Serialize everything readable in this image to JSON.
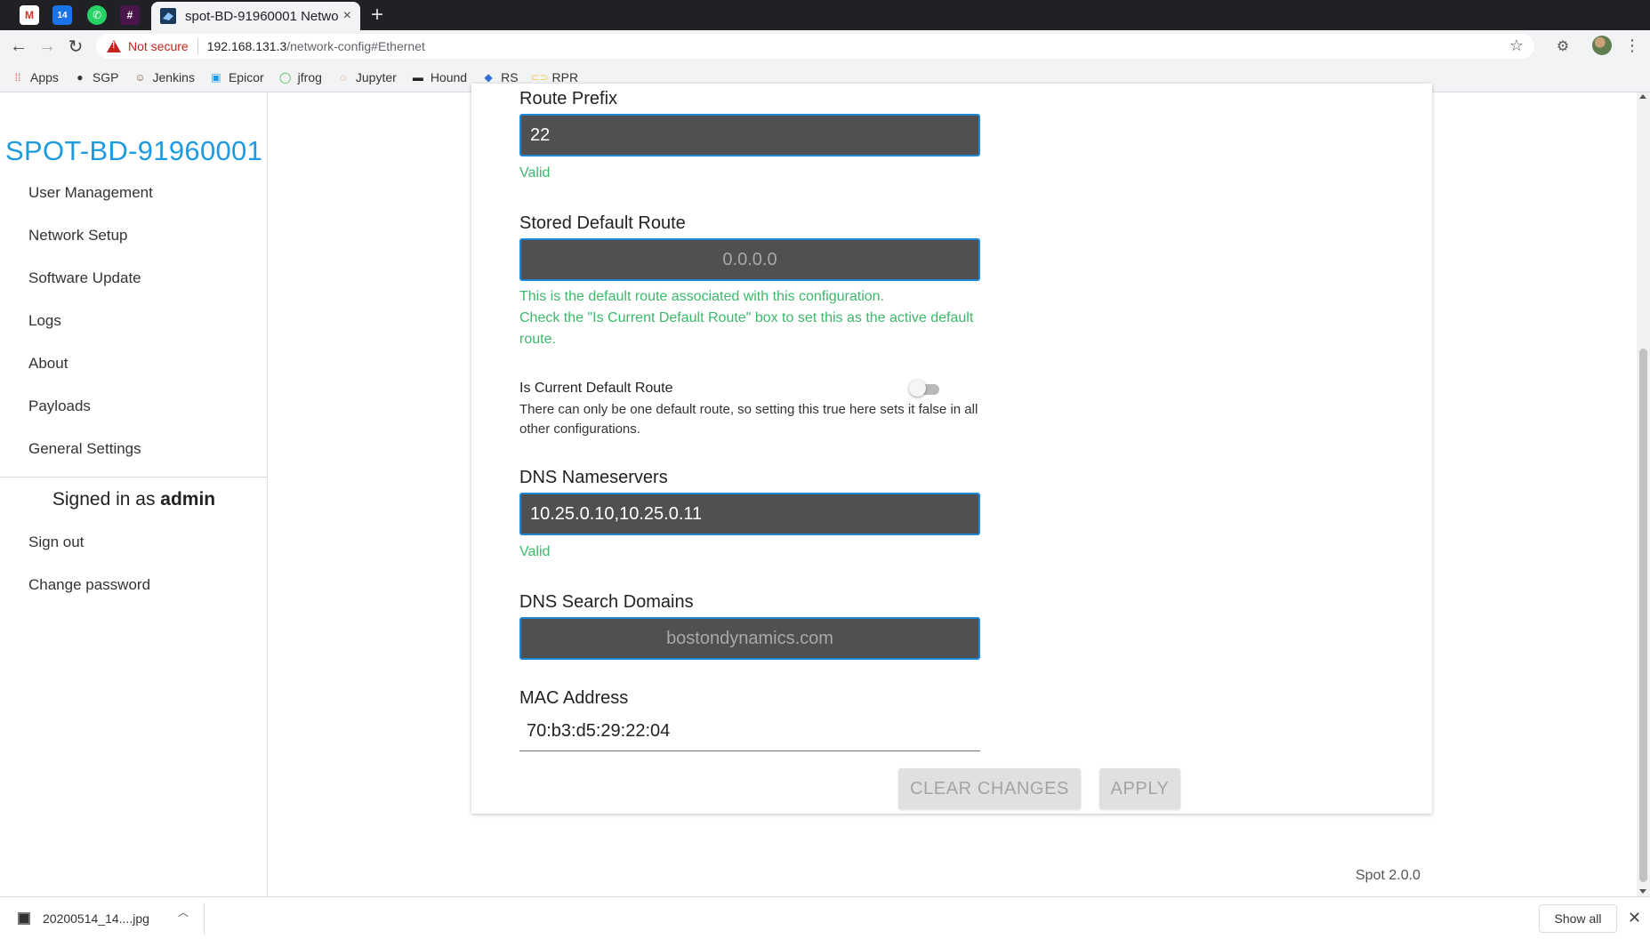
{
  "browser": {
    "tab_title": "spot-BD-91960001 Netwo",
    "tab_close": "×",
    "new_tab": "+",
    "not_secure": "Not secure",
    "url_host": "192.168.131.3",
    "url_path": "/network-config#Ethernet",
    "pinned_tab_badge": "14",
    "bookmarks": [
      {
        "label": "Apps",
        "icon": "apps-grid-icon"
      },
      {
        "label": "SGP",
        "icon": "globe-icon"
      },
      {
        "label": "Jenkins",
        "icon": "jenkins-icon"
      },
      {
        "label": "Epicor",
        "icon": "epicor-icon"
      },
      {
        "label": "jfrog",
        "icon": "jfrog-icon"
      },
      {
        "label": "Jupyter",
        "icon": "jupyter-icon"
      },
      {
        "label": "Hound",
        "icon": "hound-icon"
      },
      {
        "label": "RS",
        "icon": "diamond-icon"
      },
      {
        "label": "RPR",
        "icon": "link-icon"
      }
    ]
  },
  "sidebar": {
    "brand": "SPOT-BD-91960001",
    "nav": [
      "User Management",
      "Network Setup",
      "Software Update",
      "Logs",
      "About",
      "Payloads",
      "General Settings"
    ],
    "signed_in_prefix": "Signed in as",
    "signed_in_user": "admin",
    "account": [
      "Sign out",
      "Change password"
    ]
  },
  "form": {
    "route_prefix": {
      "label": "Route Prefix",
      "value": "22",
      "status": "Valid"
    },
    "stored_default_route": {
      "label": "Stored Default Route",
      "placeholder": "0.0.0.0",
      "hint_line1": "This is the default route associated with this configuration.",
      "hint_line2": "Check the \"Is Current Default Route\" box to set this as the active default route."
    },
    "is_current_default_route": {
      "label": "Is Current Default Route",
      "checked": false,
      "help": "There can only be one default route, so setting this true here sets it false in all other configurations."
    },
    "dns_nameservers": {
      "label": "DNS Nameservers",
      "value": "10.25.0.10,10.25.0.11",
      "status": "Valid"
    },
    "dns_search_domains": {
      "label": "DNS Search Domains",
      "placeholder": "bostondynamics.com"
    },
    "mac_address": {
      "label": "MAC Address",
      "value": "70:b3:d5:29:22:04"
    },
    "buttons": {
      "clear": "CLEAR CHANGES",
      "apply": "APPLY"
    }
  },
  "footer": {
    "version": "Spot 2.0.0"
  },
  "downloads": {
    "filename": "20200514_14....jpg",
    "show_all": "Show all"
  },
  "colors": {
    "accent": "#1e9ae0",
    "valid": "#3cb86b",
    "input_bg": "#505050",
    "input_border": "#1e88d6"
  }
}
